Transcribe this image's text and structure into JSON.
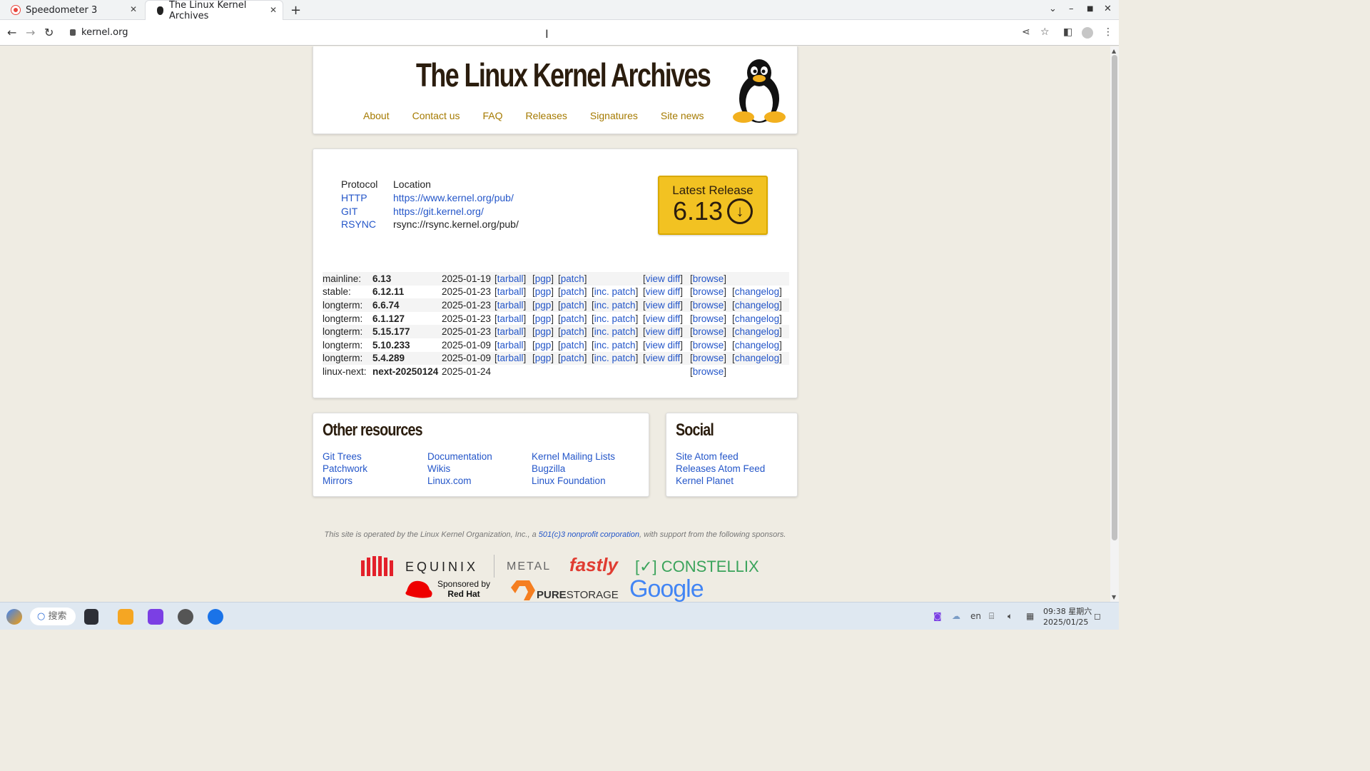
{
  "browser": {
    "tabs": [
      {
        "title": "Speedometer 3",
        "active": false
      },
      {
        "title": "The Linux Kernel Archives",
        "active": true
      }
    ],
    "url": "kernel.org"
  },
  "site": {
    "title": "The Linux Kernel Archives",
    "nav": [
      "About",
      "Contact us",
      "FAQ",
      "Releases",
      "Signatures",
      "Site news"
    ],
    "protocols": {
      "header_protocol": "Protocol",
      "header_location": "Location",
      "rows": [
        {
          "protocol": "HTTP",
          "location": "https://www.kernel.org/pub/",
          "linked": true
        },
        {
          "protocol": "GIT",
          "location": "https://git.kernel.org/",
          "linked": true
        },
        {
          "protocol": "RSYNC",
          "location": "rsync://rsync.kernel.org/pub/",
          "linked": false
        }
      ]
    },
    "latest_release": {
      "label": "Latest Release",
      "version": "6.13",
      "icon": "download-circle-icon"
    },
    "releases": [
      {
        "branch": "mainline:",
        "version": "6.13",
        "date": "2025-01-19",
        "tarball": "tarball",
        "pgp": "pgp",
        "patch": "patch",
        "inc_patch": "",
        "view_diff": "view diff",
        "browse": "browse",
        "changelog": ""
      },
      {
        "branch": "stable:",
        "version": "6.12.11",
        "date": "2025-01-23",
        "tarball": "tarball",
        "pgp": "pgp",
        "patch": "patch",
        "inc_patch": "inc. patch",
        "view_diff": "view diff",
        "browse": "browse",
        "changelog": "changelog"
      },
      {
        "branch": "longterm:",
        "version": "6.6.74",
        "date": "2025-01-23",
        "tarball": "tarball",
        "pgp": "pgp",
        "patch": "patch",
        "inc_patch": "inc. patch",
        "view_diff": "view diff",
        "browse": "browse",
        "changelog": "changelog"
      },
      {
        "branch": "longterm:",
        "version": "6.1.127",
        "date": "2025-01-23",
        "tarball": "tarball",
        "pgp": "pgp",
        "patch": "patch",
        "inc_patch": "inc. patch",
        "view_diff": "view diff",
        "browse": "browse",
        "changelog": "changelog"
      },
      {
        "branch": "longterm:",
        "version": "5.15.177",
        "date": "2025-01-23",
        "tarball": "tarball",
        "pgp": "pgp",
        "patch": "patch",
        "inc_patch": "inc. patch",
        "view_diff": "view diff",
        "browse": "browse",
        "changelog": "changelog"
      },
      {
        "branch": "longterm:",
        "version": "5.10.233",
        "date": "2025-01-09",
        "tarball": "tarball",
        "pgp": "pgp",
        "patch": "patch",
        "inc_patch": "inc. patch",
        "view_diff": "view diff",
        "browse": "browse",
        "changelog": "changelog"
      },
      {
        "branch": "longterm:",
        "version": "5.4.289",
        "date": "2025-01-09",
        "tarball": "tarball",
        "pgp": "pgp",
        "patch": "patch",
        "inc_patch": "inc. patch",
        "view_diff": "view diff",
        "browse": "browse",
        "changelog": "changelog"
      },
      {
        "branch": "linux-next:",
        "version": "next-20250124",
        "date": "2025-01-24",
        "tarball": "",
        "pgp": "",
        "patch": "",
        "inc_patch": "",
        "view_diff": "",
        "browse": "browse",
        "changelog": ""
      }
    ],
    "other_resources": {
      "title": "Other resources",
      "col1": [
        "Git Trees",
        "Patchwork",
        "Mirrors"
      ],
      "col2": [
        "Documentation",
        "Wikis",
        "Linux.com"
      ],
      "col3": [
        "Kernel Mailing Lists",
        "Bugzilla",
        "Linux Foundation"
      ]
    },
    "social": {
      "title": "Social",
      "links": [
        "Site Atom feed",
        "Releases Atom Feed",
        "Kernel Planet"
      ]
    },
    "footer": {
      "before": "This site is operated by the Linux Kernel Organization, Inc., a ",
      "link": "501(c)3 nonprofit corporation",
      "after": ", with support from the following sponsors."
    },
    "sponsors": {
      "equinix": "EQUINIX",
      "metal": "METAL",
      "fastly": "fastly",
      "constellix": "[✓] CONSTELLIX",
      "redhat_line1": "Sponsored by",
      "redhat_line2": "Red Hat",
      "purestorage_a": "PURE",
      "purestorage_b": "STORAGE",
      "google": "Google"
    }
  },
  "taskbar": {
    "search_placeholder": "搜索",
    "lang": "en",
    "time": "09:38 星期六",
    "date": "2025/01/25"
  },
  "colors": {
    "page_bg": "#efece3",
    "link": "#2456c9",
    "nav_link": "#a57a00",
    "latest_release_bg": "#f2c222",
    "title_text": "#2b1d0e"
  }
}
